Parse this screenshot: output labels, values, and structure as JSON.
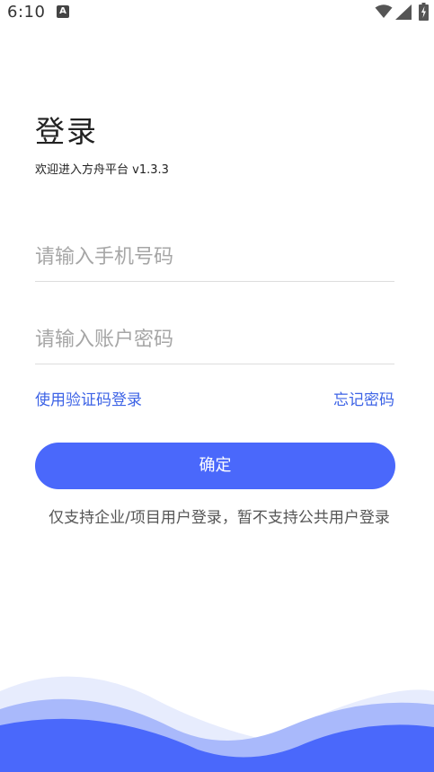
{
  "status_bar": {
    "time": "6:10",
    "notification_icon": "font-a-notification-icon",
    "icons": [
      "wifi-icon",
      "signal-icon",
      "battery-charging-icon"
    ]
  },
  "header": {
    "title": "登录",
    "welcome": "欢迎进入方舟平台 v1.3.3"
  },
  "form": {
    "phone_placeholder": "请输入手机号码",
    "password_placeholder": "请输入账户密码",
    "sms_login_link": "使用验证码登录",
    "forgot_password_link": "忘记密码",
    "submit_label": "确定",
    "notice": "仅支持企业/项目用户登录，暂不支持公共用户登录"
  },
  "colors": {
    "accent": "#4a68fb",
    "link": "#3d63e6",
    "wave_light": "#e7ecfd",
    "wave_mid": "#a9b9fb",
    "wave_dark": "#4a68fb"
  }
}
